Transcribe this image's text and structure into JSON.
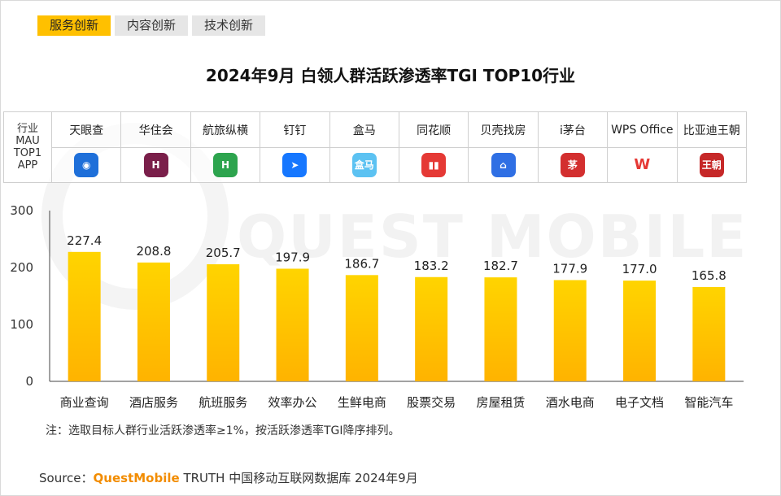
{
  "tabs": [
    {
      "label": "服务创新",
      "active": true
    },
    {
      "label": "内容创新",
      "active": false
    },
    {
      "label": "技术创新",
      "active": false
    }
  ],
  "title": "2024年9月  白领人群活跃渗透率TGI TOP10行业",
  "watermark": "QUEST MOBILE",
  "app_table": {
    "row_header": [
      "行业",
      "MAU",
      "TOP1",
      "APP"
    ],
    "apps": [
      {
        "name": "天眼查",
        "icon": "tianyancha-app-icon",
        "color": "#1e6fd9",
        "glyph": "◉"
      },
      {
        "name": "华住会",
        "icon": "huazhuhui-app-icon",
        "color": "#7a1f4a",
        "glyph": "H"
      },
      {
        "name": "航旅纵横",
        "icon": "hanglvzongheng-app-icon",
        "color": "#2da44e",
        "glyph": "H"
      },
      {
        "name": "钉钉",
        "icon": "dingtalk-app-icon",
        "color": "#1677ff",
        "glyph": "➤"
      },
      {
        "name": "盒马",
        "icon": "hema-app-icon",
        "color": "#5cc2f2",
        "glyph": "盒马"
      },
      {
        "name": "同花顺",
        "icon": "tonghuashun-app-icon",
        "color": "#e53935",
        "glyph": "▮▮"
      },
      {
        "name": "贝壳找房",
        "icon": "beike-app-icon",
        "color": "#2f6fe4",
        "glyph": "⌂"
      },
      {
        "name": "i茅台",
        "icon": "imaotai-app-icon",
        "color": "#d32f2f",
        "glyph": "茅"
      },
      {
        "name": "WPS Office",
        "icon": "wps-office-app-icon",
        "color": "#ffffff",
        "glyph": "W"
      },
      {
        "name": "比亚迪王朝",
        "icon": "byd-dynasty-app-icon",
        "color": "#c62828",
        "glyph": "王朝"
      }
    ]
  },
  "colors": {
    "bar_top": "#ffd400",
    "bar_bottom": "#ffb300",
    "accent": "#ffc000",
    "brand": "#f28c00"
  },
  "chart_data": {
    "type": "bar",
    "categories": [
      "商业查询",
      "酒店服务",
      "航班服务",
      "效率办公",
      "生鲜电商",
      "股票交易",
      "房屋租赁",
      "酒水电商",
      "电子文档",
      "智能汽车"
    ],
    "values": [
      227.4,
      208.8,
      205.7,
      197.9,
      186.7,
      183.2,
      182.7,
      177.9,
      177.0,
      165.8
    ],
    "value_labels": [
      "227.4",
      "208.8",
      "205.7",
      "197.9",
      "186.7",
      "183.2",
      "182.7",
      "177.9",
      "177.0",
      "165.8"
    ],
    "yticks": [
      "300",
      "200",
      "100",
      "0"
    ],
    "ylim": [
      0,
      300
    ],
    "grid": false
  },
  "note": "注：选取目标人群行业活跃渗透率≥1%，按活跃渗透率TGI降序排列。",
  "source": {
    "prefix": "Source：",
    "brand": "QuestMobile",
    "rest": " TRUTH 中国移动互联网数据库 2024年9月"
  }
}
